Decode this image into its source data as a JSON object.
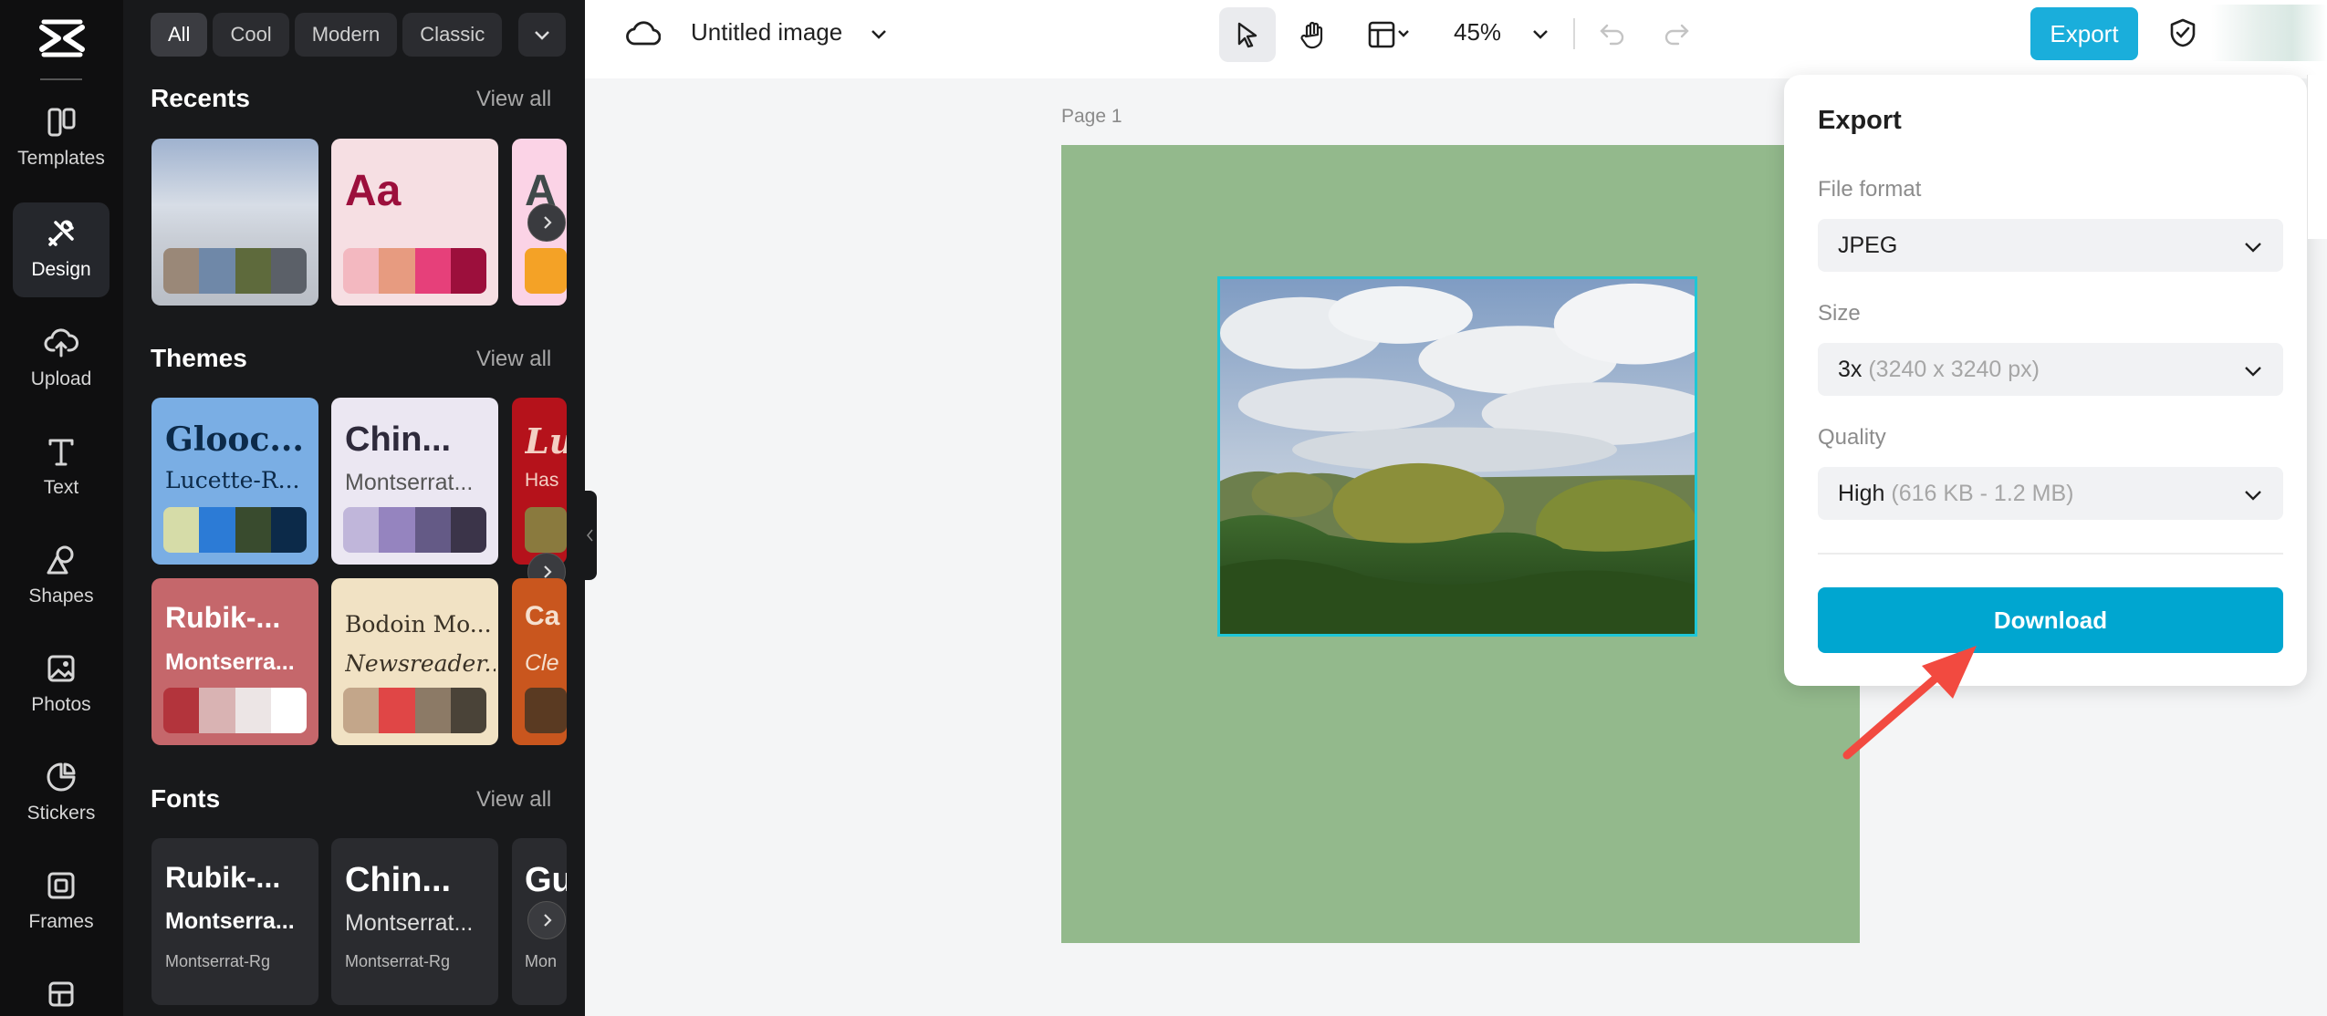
{
  "rail": {
    "items": [
      {
        "label": "Templates",
        "icon": "templates-icon"
      },
      {
        "label": "Design",
        "icon": "design-icon"
      },
      {
        "label": "Upload",
        "icon": "upload-icon"
      },
      {
        "label": "Text",
        "icon": "text-icon"
      },
      {
        "label": "Shapes",
        "icon": "shapes-icon"
      },
      {
        "label": "Photos",
        "icon": "photos-icon"
      },
      {
        "label": "Stickers",
        "icon": "stickers-icon"
      },
      {
        "label": "Frames",
        "icon": "frames-icon"
      }
    ]
  },
  "panel": {
    "chips": [
      "All",
      "Cool",
      "Modern",
      "Classic"
    ],
    "recents": {
      "title": "Recents",
      "view_all": "View all",
      "cards": [
        {
          "swatches": [
            "#9a8878",
            "#6f88a8",
            "#5e6a3c",
            "#5b6068"
          ]
        },
        {
          "text": "Aa",
          "swatches": [
            "#f3b8c0",
            "#e79b80",
            "#e6407a",
            "#9c0f3c"
          ]
        },
        {
          "text": "A",
          "swatches": [
            "#f4a226"
          ]
        }
      ]
    },
    "themes": {
      "title": "Themes",
      "view_all": "View all",
      "cards": [
        {
          "title": "Glooc...",
          "subtitle": "Lucette-R...",
          "swatches": [
            "#d6dca8",
            "#2c7bd6",
            "#394b2e",
            "#0c2a49"
          ]
        },
        {
          "title": "Chin...",
          "subtitle": "Montserrat...",
          "swatches": [
            "#c0b6da",
            "#9584bf",
            "#645a86",
            "#3b3449"
          ]
        },
        {
          "title": "Lu",
          "subtitle": "Has",
          "swatches": [
            "#8a7a3e"
          ]
        },
        {
          "title": "Rubik-...",
          "subtitle": "Montserra...",
          "swatches": [
            "#b3343c",
            "#d9b3b3",
            "#ece5e5",
            "#ffffff"
          ]
        },
        {
          "title": "Bodoin Mo...",
          "subtitle": "Newsreader...",
          "swatches": [
            "#c3a68a",
            "#e04646",
            "#8c7a66",
            "#4a4338"
          ]
        },
        {
          "title": "Ca",
          "subtitle": "Cle",
          "swatches": [
            "#5a3a22"
          ]
        }
      ]
    },
    "fonts": {
      "title": "Fonts",
      "view_all": "View all",
      "cards": [
        {
          "title": "Rubik-...",
          "subtitle": "Montserra...",
          "caption": "Montserrat-Rg"
        },
        {
          "title": "Chin...",
          "subtitle": "Montserrat...",
          "caption": "Montserrat-Rg"
        },
        {
          "title": "Gu",
          "subtitle": "",
          "caption": "Mon"
        }
      ]
    }
  },
  "topbar": {
    "doc_title": "Untitled image",
    "zoom": "45%",
    "export_label": "Export"
  },
  "canvas": {
    "page_label": "Page 1",
    "page_color": "#93b98c"
  },
  "export_panel": {
    "title": "Export",
    "file_format": {
      "label": "File format",
      "value": "JPEG"
    },
    "size": {
      "label": "Size",
      "value": "3x",
      "detail": "(3240 x 3240 px)"
    },
    "quality": {
      "label": "Quality",
      "value": "High",
      "detail": "(616 KB - 1.2 MB)"
    },
    "download_label": "Download"
  },
  "colors": {
    "accent": "#1aaedb",
    "download": "#00a6d0",
    "selection": "#1fc6d6",
    "annotation_arrow": "#f24a40"
  }
}
